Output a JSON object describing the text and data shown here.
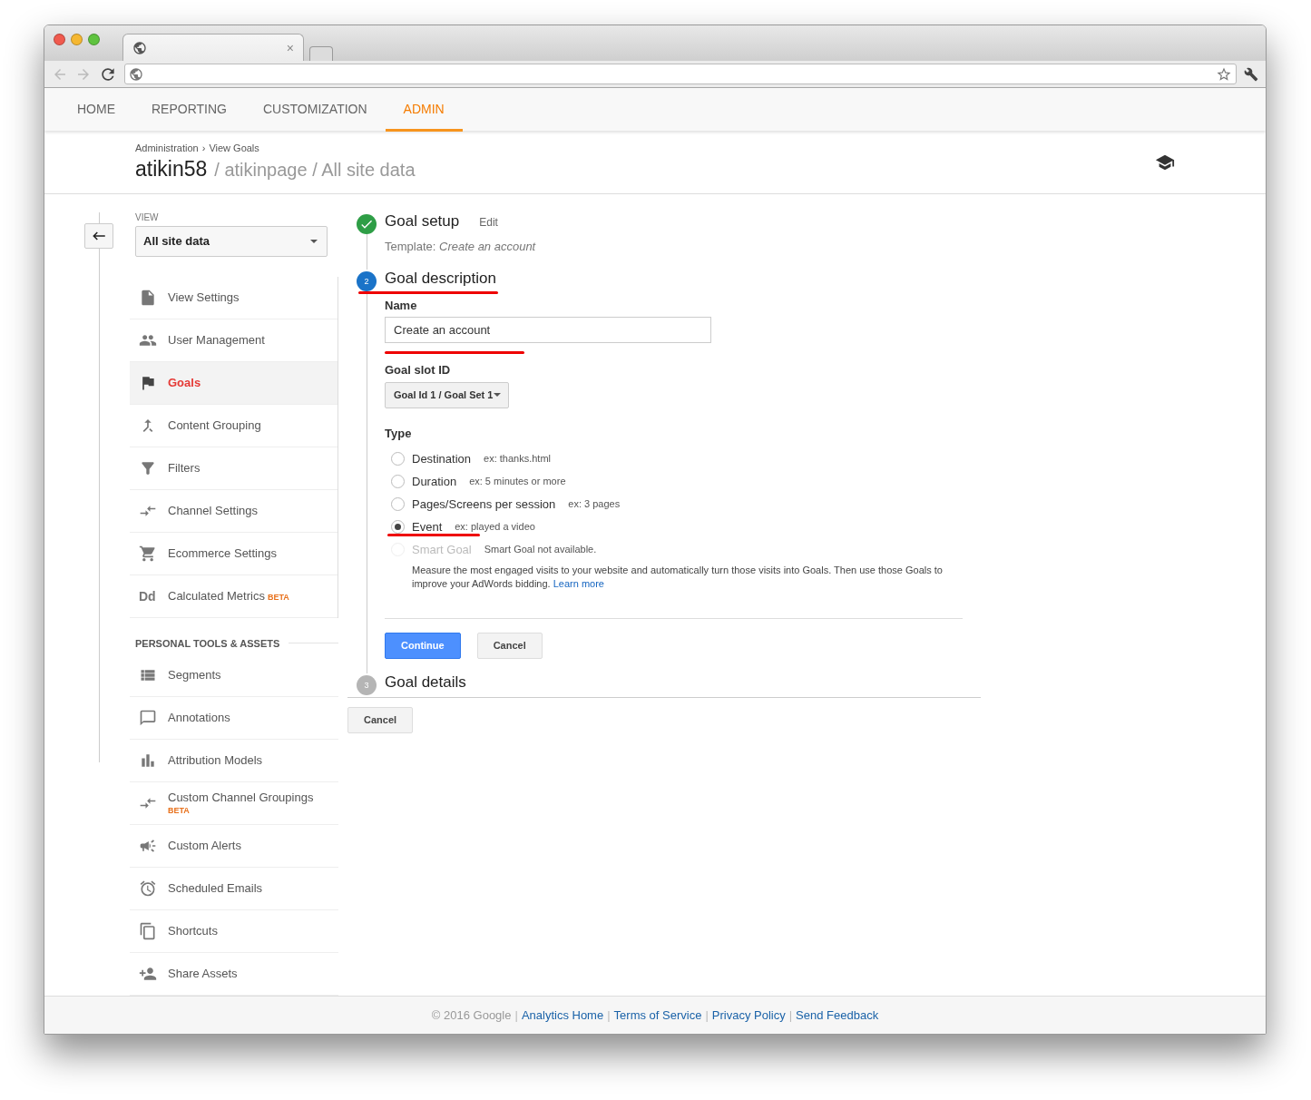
{
  "browser": {
    "tab_close": "×"
  },
  "nav": {
    "tabs": [
      {
        "label": "HOME",
        "selected": false
      },
      {
        "label": "REPORTING",
        "selected": false
      },
      {
        "label": "CUSTOMIZATION",
        "selected": false
      },
      {
        "label": "ADMIN",
        "selected": true
      }
    ]
  },
  "header": {
    "breadcrumb": [
      "Administration",
      "View Goals"
    ],
    "breadcrumb_separator": "›",
    "account": "atikin58",
    "path": "/ atikinpage / All site data"
  },
  "sidebar": {
    "view_label": "VIEW",
    "view_select": "All site data",
    "items": [
      {
        "kind": "document",
        "label": "View Settings",
        "selected": false
      },
      {
        "kind": "people",
        "label": "User Management",
        "selected": false
      },
      {
        "kind": "flag",
        "label": "Goals",
        "selected": true
      },
      {
        "kind": "merge",
        "label": "Content Grouping",
        "selected": false
      },
      {
        "kind": "filter",
        "label": "Filters",
        "selected": false
      },
      {
        "kind": "channels",
        "label": "Channel Settings",
        "selected": false
      },
      {
        "kind": "cart",
        "label": "Ecommerce Settings",
        "selected": false
      },
      {
        "kind": "text",
        "icon_text": "Dd",
        "label": "Calculated Metrics",
        "badge": "BETA",
        "selected": false
      }
    ],
    "section_title": "PERSONAL TOOLS & ASSETS",
    "tools": [
      {
        "kind": "segments",
        "label": "Segments",
        "selected": false
      },
      {
        "kind": "comment",
        "label": "Annotations",
        "selected": false
      },
      {
        "kind": "bars",
        "label": "Attribution Models",
        "selected": false
      },
      {
        "kind": "channels",
        "label": "Custom Channel Groupings",
        "badge_below": "BETA",
        "selected": false
      },
      {
        "kind": "megaphone",
        "label": "Custom Alerts",
        "selected": false
      },
      {
        "kind": "alarm",
        "label": "Scheduled Emails",
        "selected": false
      },
      {
        "kind": "copy",
        "label": "Shortcuts",
        "selected": false
      },
      {
        "kind": "person-add",
        "label": "Share Assets",
        "selected": false
      }
    ]
  },
  "steps": [
    {
      "done": true,
      "active": false,
      "title": "Goal setup",
      "edit": "Edit",
      "template_label": "Template:",
      "template_value": "Create an account"
    },
    {
      "done": false,
      "active": true,
      "number": "2",
      "title": "Goal description"
    },
    {
      "done": false,
      "active": false,
      "number": "3",
      "title": "Goal details"
    }
  ],
  "form": {
    "name_label": "Name",
    "name_value": "Create an account",
    "slot_label": "Goal slot ID",
    "slot_value": "Goal Id 1 / Goal Set 1",
    "type_label": "Type",
    "types": [
      {
        "label": "Destination",
        "example": "ex: thanks.html",
        "selected": false,
        "disabled": false
      },
      {
        "label": "Duration",
        "example": "ex: 5 minutes or more",
        "selected": false,
        "disabled": false
      },
      {
        "label": "Pages/Screens per session",
        "example": "ex: 3 pages",
        "selected": false,
        "disabled": false
      },
      {
        "label": "Event",
        "example": "ex: played a video",
        "selected": true,
        "disabled": false
      },
      {
        "label": "Smart Goal",
        "example": "Smart Goal not available.",
        "selected": false,
        "disabled": true
      }
    ],
    "smart_goal_description": "Measure the most engaged visits to your website and automatically turn those visits into Goals. Then use those Goals to improve your AdWords bidding.",
    "learn_more": "Learn more",
    "continue": "Continue",
    "cancel": "Cancel"
  },
  "bottom_cancel": "Cancel",
  "footer": {
    "copyright": "© 2016 Google",
    "separator": "|",
    "links": [
      "Analytics Home",
      "Terms of Service",
      "Privacy Policy",
      "Send Feedback"
    ]
  }
}
